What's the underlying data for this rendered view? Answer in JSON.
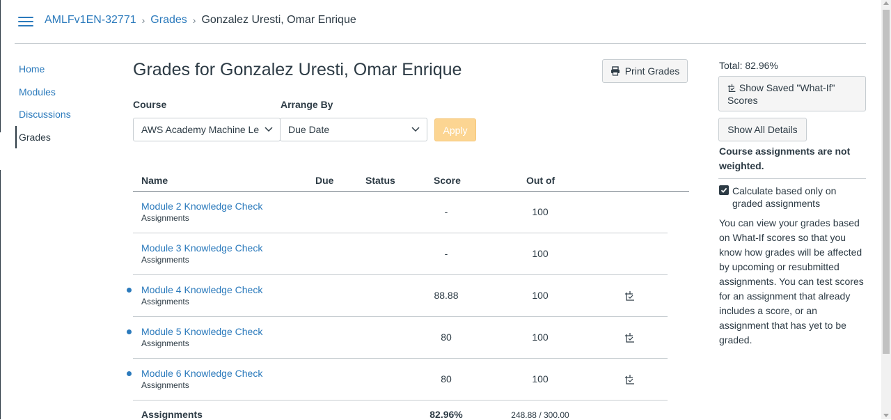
{
  "breadcrumb": {
    "course": "AMLFv1EN-32771",
    "section": "Grades",
    "student": "Gonzalez Uresti, Omar Enrique"
  },
  "nav": [
    {
      "label": "Home"
    },
    {
      "label": "Modules"
    },
    {
      "label": "Discussions"
    },
    {
      "label": "Grades"
    }
  ],
  "page": {
    "title": "Grades for Gonzalez Uresti, Omar Enrique",
    "print_label": "Print Grades"
  },
  "filters": {
    "course_label": "Course",
    "course_value": "AWS Academy Machine Le",
    "arrange_label": "Arrange By",
    "arrange_value": "Due Date",
    "apply_label": "Apply"
  },
  "table": {
    "headers": {
      "name": "Name",
      "due": "Due",
      "status": "Status",
      "score": "Score",
      "out_of": "Out of"
    },
    "rows": [
      {
        "name": "Module 2 Knowledge Check",
        "group": "Assignments",
        "due": "",
        "status": "",
        "score": "-",
        "out_of": "100",
        "unread": false,
        "whatif": false
      },
      {
        "name": "Module 3 Knowledge Check",
        "group": "Assignments",
        "due": "",
        "status": "",
        "score": "-",
        "out_of": "100",
        "unread": false,
        "whatif": false
      },
      {
        "name": "Module 4 Knowledge Check",
        "group": "Assignments",
        "due": "",
        "status": "",
        "score": "88.88",
        "out_of": "100",
        "unread": true,
        "whatif": true
      },
      {
        "name": "Module 5 Knowledge Check",
        "group": "Assignments",
        "due": "",
        "status": "",
        "score": "80",
        "out_of": "100",
        "unread": true,
        "whatif": true
      },
      {
        "name": "Module 6 Knowledge Check",
        "group": "Assignments",
        "due": "",
        "status": "",
        "score": "80",
        "out_of": "100",
        "unread": true,
        "whatif": true
      }
    ],
    "summary": {
      "name": "Assignments",
      "score": "82.96%",
      "out_of": "248.88 / 300.00"
    }
  },
  "sidebar": {
    "total": "Total: 82.96%",
    "whatif_button": "Show Saved \"What-If\" Scores",
    "details_button": "Show All Details",
    "weighted_note": "Course assignments are not weighted.",
    "calc_label": "Calculate based only on graded assignments",
    "calc_checked": true,
    "info": "You can view your grades based on What-If scores so that you know how grades will be affected by upcoming or resubmitted assignments. You can test scores for an assignment that already includes a score, or an assignment that has yet to be graded."
  },
  "colors": {
    "link": "#2b7abc",
    "text": "#2d3b45",
    "apply_disabled": "#fcd592",
    "border": "#c7cdd1"
  }
}
